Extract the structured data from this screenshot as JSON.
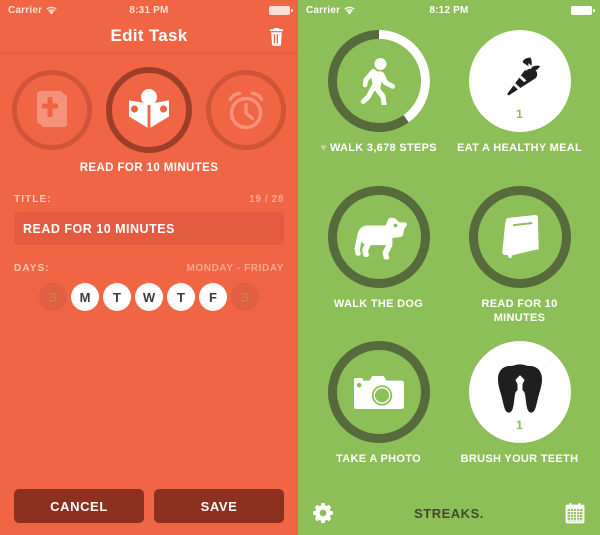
{
  "left": {
    "status": {
      "carrier": "Carrier",
      "time": "8:31 PM",
      "wifi_icon": "wifi-icon",
      "battery_icon": "battery-full-icon"
    },
    "nav": {
      "title": "Edit Task",
      "delete_icon": "trash-icon"
    },
    "icon_picker": {
      "options": [
        {
          "icon": "bible-icon",
          "selected": false
        },
        {
          "icon": "open-book-icon",
          "selected": true
        },
        {
          "icon": "alarm-clock-icon",
          "selected": false
        }
      ]
    },
    "task_title_display": "READ FOR 10 MINUTES",
    "title_field": {
      "label": "TITLE:",
      "counter": "19 / 28",
      "value": "READ FOR 10 MINUTES",
      "placeholder": "TITLE"
    },
    "days_field": {
      "label": "DAYS:",
      "summary": "MONDAY - FRIDAY",
      "days": [
        {
          "letter": "S",
          "name": "sunday",
          "selected": false
        },
        {
          "letter": "M",
          "name": "monday",
          "selected": true
        },
        {
          "letter": "T",
          "name": "tuesday",
          "selected": true
        },
        {
          "letter": "W",
          "name": "wednesday",
          "selected": true
        },
        {
          "letter": "T",
          "name": "thursday",
          "selected": true
        },
        {
          "letter": "F",
          "name": "friday",
          "selected": true
        },
        {
          "letter": "S",
          "name": "saturday",
          "selected": false
        }
      ]
    },
    "buttons": {
      "cancel": "CANCEL",
      "save": "SAVE"
    },
    "colors": {
      "background": "#f06543",
      "field": "#e35c3f",
      "button": "#8c3020",
      "ring": "#5a2012"
    }
  },
  "right": {
    "status": {
      "carrier": "Carrier",
      "time": "8:12 PM",
      "wifi_icon": "wifi-icon",
      "battery_icon": "battery-full-icon"
    },
    "tasks": [
      {
        "icon": "walking-person-icon",
        "label": "WALK 3,678 STEPS",
        "heart": "♥",
        "state": "progress",
        "progress": 40,
        "count": ""
      },
      {
        "icon": "carrot-icon",
        "label": "EAT A HEALTHY MEAL",
        "heart": "",
        "state": "done",
        "progress": 100,
        "count": "1"
      },
      {
        "icon": "dog-icon",
        "label": "WALK THE DOG",
        "heart": "",
        "state": "empty",
        "progress": 0,
        "count": ""
      },
      {
        "icon": "closed-book-icon",
        "label": "READ FOR 10 MINUTES",
        "heart": "",
        "state": "empty",
        "progress": 0,
        "count": ""
      },
      {
        "icon": "camera-icon",
        "label": "TAKE A PHOTO",
        "heart": "",
        "state": "empty",
        "progress": 0,
        "count": ""
      },
      {
        "icon": "tooth-icon",
        "label": "BRUSH YOUR TEETH",
        "heart": "",
        "state": "done",
        "progress": 100,
        "count": "1"
      }
    ],
    "tabbar": {
      "settings_icon": "gear-icon",
      "title": "STREAKS.",
      "calendar_icon": "calendar-icon"
    },
    "colors": {
      "background": "#8cbf58",
      "ring": "#566b3c",
      "progress": "#ffffff",
      "accent": "#3f4a2d"
    }
  }
}
